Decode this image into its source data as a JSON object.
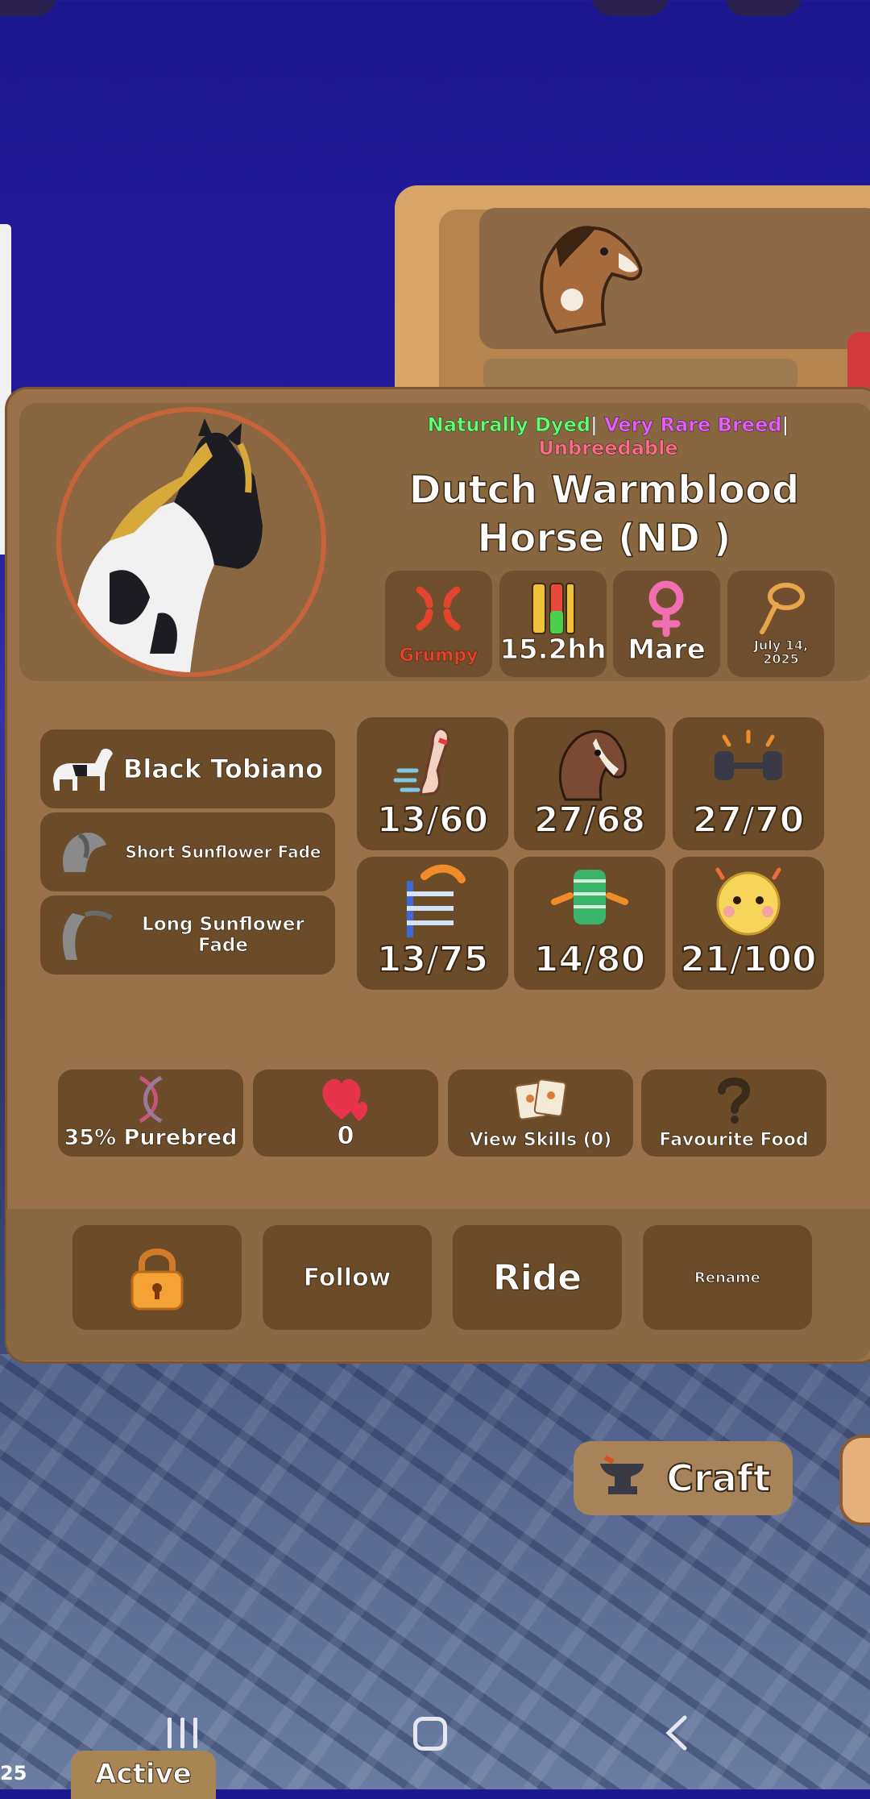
{
  "tags": {
    "naturally_dyed": "Naturally Dyed",
    "separator": "|",
    "rarity": "Very Rare Breed",
    "breedable": "Unbreedable"
  },
  "horse": {
    "name": "Dutch Warmblood Horse (ND )"
  },
  "stats": [
    {
      "icon": "grumpy-anger-icon",
      "label": "Grumpy",
      "color": "#e3442b"
    },
    {
      "icon": "height-ruler-icon",
      "label": "15.2hh",
      "color": "#ffffff"
    },
    {
      "icon": "female-symbol-icon",
      "label": "Mare",
      "color": "#ffffff"
    },
    {
      "icon": "lasso-icon",
      "label": "July 14, 2025",
      "color": "#ffffff"
    }
  ],
  "coat": [
    {
      "icon": "horse-silhouette-icon",
      "label": "Black Tobiano"
    },
    {
      "icon": "mane-icon",
      "label": "Short Sunflower Fade"
    },
    {
      "icon": "tail-icon",
      "label": "Long Sunflower Fade"
    }
  ],
  "skills": [
    {
      "icon": "speed-leg-icon",
      "value": "13/60"
    },
    {
      "icon": "horse-head-icon",
      "value": "27/68"
    },
    {
      "icon": "dumbbell-icon",
      "value": "27/70"
    },
    {
      "icon": "jump-hurdle-icon",
      "value": "13/75"
    },
    {
      "icon": "endurance-drum-icon",
      "value": "14/80"
    },
    {
      "icon": "happy-face-icon",
      "value": "21/100"
    }
  ],
  "info": {
    "purebred": "35% Purebred",
    "hearts": "0",
    "view_skills": "View Skills (0)",
    "favourite_food": "Favourite Food"
  },
  "actions": {
    "lock": "lock-icon",
    "follow": "Follow",
    "ride": "Ride",
    "rename": "Rename"
  },
  "background": {
    "craft": "Craft"
  },
  "status": {
    "active": "Active",
    "corner_number": "25"
  }
}
